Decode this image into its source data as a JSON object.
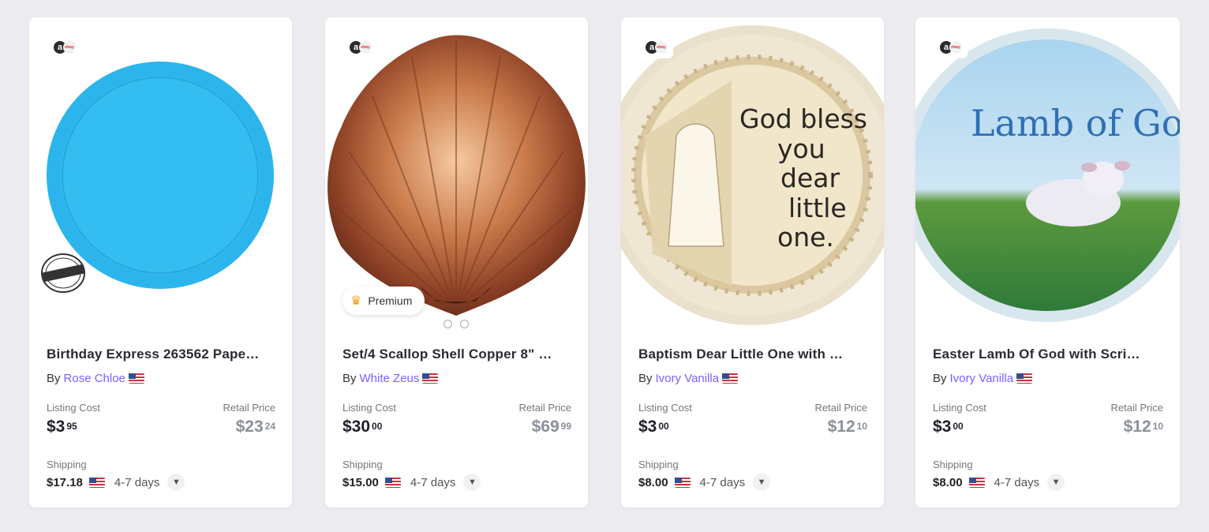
{
  "products": [
    {
      "title": "Birthday Express 263562 Pape…",
      "by": "By",
      "seller": "Rose Chloe",
      "listing_cost_label": "Listing Cost",
      "listing_cost_dollars": "$3",
      "listing_cost_cents": "95",
      "retail_price_label": "Retail Price",
      "retail_price_dollars": "$23",
      "retail_price_cents": "24",
      "shipping_label": "Shipping",
      "shipping_cost": "$17.18",
      "shipping_days": "4-7 days",
      "stamp_text": "PREMIUM STRENGTH PLATES"
    },
    {
      "title": "Set/4 Scallop Shell Copper 8\" …",
      "by": "By",
      "seller": "White Zeus",
      "premium_label": "Premium",
      "listing_cost_label": "Listing Cost",
      "listing_cost_dollars": "$30",
      "listing_cost_cents": "00",
      "retail_price_label": "Retail Price",
      "retail_price_dollars": "$69",
      "retail_price_cents": "99",
      "shipping_label": "Shipping",
      "shipping_cost": "$15.00",
      "shipping_days": "4-7 days"
    },
    {
      "title": "Baptism Dear Little One with …",
      "by": "By",
      "seller": "Ivory Vanilla",
      "plate_text": [
        "God bless",
        "you",
        "dear",
        "little",
        "one."
      ],
      "listing_cost_label": "Listing Cost",
      "listing_cost_dollars": "$3",
      "listing_cost_cents": "00",
      "retail_price_label": "Retail Price",
      "retail_price_dollars": "$12",
      "retail_price_cents": "10",
      "shipping_label": "Shipping",
      "shipping_cost": "$8.00",
      "shipping_days": "4-7 days"
    },
    {
      "title": "Easter Lamb Of God with Scri…",
      "by": "By",
      "seller": "Ivory Vanilla",
      "plate_text": "Lamb of God",
      "listing_cost_label": "Listing Cost",
      "listing_cost_dollars": "$3",
      "listing_cost_cents": "00",
      "retail_price_label": "Retail Price",
      "retail_price_dollars": "$12",
      "retail_price_cents": "10",
      "shipping_label": "Shipping",
      "shipping_cost": "$8.00",
      "shipping_days": "4-7 days"
    }
  ],
  "colors": {
    "seller_link": "#7b61ff",
    "page_bg": "#ececf0",
    "premium_crown": "#f39c12"
  },
  "icons": {
    "source_badge": "amazon-ebay-icon",
    "flag": "us-flag-icon",
    "expand": "chevron-down-icon",
    "premium": "crown-icon"
  }
}
